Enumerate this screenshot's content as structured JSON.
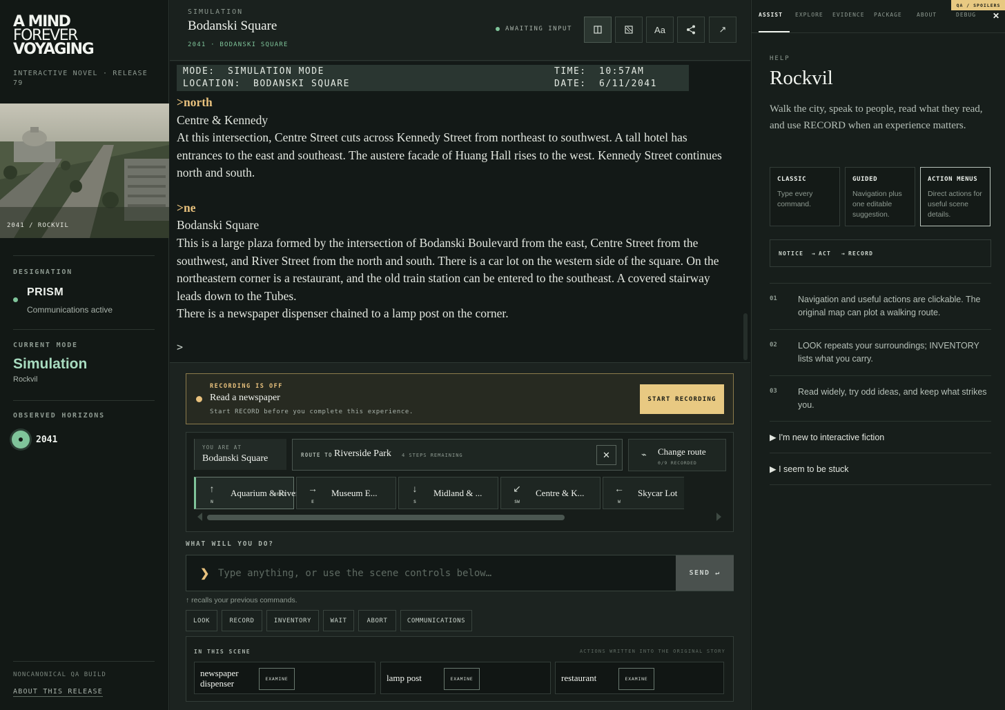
{
  "app": {
    "title_line1": "A MIND",
    "title_line2": "FOREVER",
    "title_line3": "VOYAGING",
    "release": "INTERACTIVE NOVEL · RELEASE 79",
    "photo_caption": "2041 / ROCKVIL",
    "designation_label": "DESIGNATION",
    "designation_name": "PRISM",
    "designation_status": "Communications active",
    "current_mode_label": "CURRENT MODE",
    "current_mode": "Simulation",
    "current_mode_place": "Rockvil",
    "horizons_label": "OBSERVED HORIZONS",
    "horizon_year": "2041",
    "qa_build": "NONCANONICAL QA BUILD",
    "about_release": "ABOUT THIS RELEASE"
  },
  "header": {
    "label": "SIMULATION",
    "title": "Bodanski Square",
    "subtitle": "2041 · BODANSKI SQUARE",
    "status": "AWAITING INPUT",
    "text_size_label": "Aa"
  },
  "statusbar": {
    "mode_label": "MODE:",
    "mode_value": "SIMULATION MODE",
    "location_label": "LOCATION:",
    "location_value": "BODANSKI SQUARE",
    "time_label": "TIME:",
    "time_value": "10:57AM",
    "date_label": "DATE:",
    "date_value": "6/11/2041"
  },
  "transcript": {
    "cmd1": ">north",
    "room1": "Centre & Kennedy",
    "desc1": "At this intersection, Centre Street cuts across Kennedy Street from northeast to southwest. A tall hotel has entrances to the east and southeast. The austere facade of Huang Hall rises to the west. Kennedy Street continues north and south.",
    "cmd2": ">ne",
    "room2": "Bodanski Square",
    "desc2": "This is a large plaza formed by the intersection of Bodanski Boulevard from the east, Centre Street from the southwest, and River Street from the north and south. There is a car lot on the western side of the square. On the northeastern corner is a restaurant, and the old train station can be entered to the southeast. A covered stairway leads down to the Tubes.",
    "desc3": "There is a newspaper dispenser chained to a lamp post on the corner.",
    "prompt": ">"
  },
  "recording": {
    "status": "RECORDING IS OFF",
    "title": "Read a newspaper",
    "subtitle": "Start RECORD before you complete this experience.",
    "button": "START RECORDING"
  },
  "nav": {
    "you_are_at_label": "YOU ARE AT",
    "you_are_at": "Bodanski Square",
    "route_label": "ROUTE TO",
    "route_dest": "Riverside Park",
    "route_steps": "4 STEPS REMAINING",
    "change_route": "Change route",
    "change_route_sub": "0/9 RECORDED",
    "next_label": "NEXT",
    "directions": [
      {
        "arrow": "↑",
        "compass": "N",
        "label": "Aquarium & River"
      },
      {
        "arrow": "→",
        "compass": "E",
        "label": "Museum E..."
      },
      {
        "arrow": "↓",
        "compass": "S",
        "label": "Midland & ..."
      },
      {
        "arrow": "↙",
        "compass": "SW",
        "label": "Centre & K..."
      },
      {
        "arrow": "←",
        "compass": "W",
        "label": "Skycar Lot"
      }
    ]
  },
  "input": {
    "prompt_label": "WHAT WILL YOU DO?",
    "placeholder": "Type anything, or use the scene controls below…",
    "send": "SEND ↵",
    "recall_hint": "↑ recalls your previous commands."
  },
  "quick_actions": [
    "LOOK",
    "RECORD",
    "INVENTORY",
    "WAIT",
    "ABORT",
    "COMMUNICATIONS"
  ],
  "scene": {
    "label": "IN THIS SCENE",
    "note": "ACTIONS WRITTEN INTO THE ORIGINAL STORY",
    "examine": "EXAMINE",
    "items": [
      "newspaper dispenser",
      "lamp post",
      "restaurant"
    ]
  },
  "right": {
    "tabs": [
      "ASSIST",
      "EXPLORE",
      "EVIDENCE",
      "PACKAGE",
      "ABOUT",
      "DEBUG"
    ],
    "qa_badge": "QA / SPOILERS",
    "help_label": "HELP",
    "help_title": "Rockvil",
    "help_desc": "Walk the city, speak to people, read what they read, and use RECORD when an experience matters.",
    "modes": [
      {
        "title": "CLASSIC",
        "desc": "Type every command."
      },
      {
        "title": "GUIDED",
        "desc": "Navigation plus one editable suggestion."
      },
      {
        "title": "ACTION MENUS",
        "desc": "Direct actions for useful scene details."
      }
    ],
    "flow": [
      "NOTICE",
      "→",
      "ACT",
      "→",
      "RECORD"
    ],
    "tips": [
      {
        "n": "01",
        "text": "Navigation and useful actions are clickable. The original map can plot a walking route."
      },
      {
        "n": "02",
        "text": "LOOK repeats your surroundings; INVENTORY lists what you carry."
      },
      {
        "n": "03",
        "text": "Read widely, try odd ideas, and keep what strikes you."
      }
    ],
    "disclosures": [
      "I'm new to interactive fiction",
      "I seem to be stuck"
    ]
  },
  "colors": {
    "accent_green": "#7fc49a",
    "accent_gold": "#e8c17d",
    "background": "#141a17"
  }
}
